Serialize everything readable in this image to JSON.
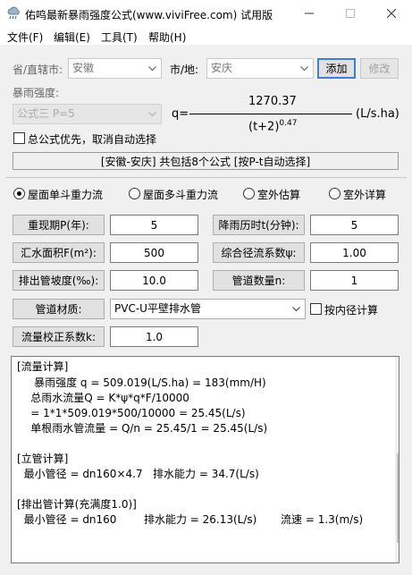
{
  "window": {
    "title": "佑鸣最新暴雨强度公式(www.viviFree.com) 试用版",
    "icon": "rain-cloud-icon"
  },
  "menu": [
    "文件(F)",
    "编辑(E)",
    "工具(T)",
    "帮助(H)"
  ],
  "location": {
    "province_label": "省/直辖市:",
    "province_value": "安徽",
    "city_label": "市/地:",
    "city_value": "安庆",
    "add_label": "添加",
    "edit_label": "修改"
  },
  "intensity": {
    "label": "暴雨强度:",
    "formula_select": "公式三 P=5",
    "q_prefix": "q=",
    "numerator": "1270.37",
    "denominator_base": "(t+2)",
    "denominator_exp": "0.47",
    "unit": "(L/s.ha)",
    "checkbox_label": "总公式优先，取消自动选择",
    "info": "[安徽-安庆] 共包括8个公式 [按P-t自动选择]"
  },
  "modes": [
    {
      "label": "屋面单斗重力流",
      "selected": true
    },
    {
      "label": "屋面多斗重力流",
      "selected": false
    },
    {
      "label": "室外估算",
      "selected": false
    },
    {
      "label": "室外详算",
      "selected": false
    }
  ],
  "params": {
    "return_period_label": "重现期P(年):",
    "return_period_value": "5",
    "duration_label": "降雨历时t(分钟):",
    "duration_value": "5",
    "area_label": "汇水面积F(m²):",
    "area_value": "500",
    "runoff_label": "综合径流系数ψ:",
    "runoff_value": "1.00",
    "slope_label": "排出管坡度(‰):",
    "slope_value": "10.0",
    "pipe_count_label": "管道数量n:",
    "pipe_count_value": "1",
    "material_label": "管道材质:",
    "material_value": "PVC-U平壁排水管",
    "inner_diam_label": "按内径计算",
    "flow_corr_label": "流量校正系数k:",
    "flow_corr_value": "1.0"
  },
  "results": [
    "[流量计算]",
    "     暴雨强度 q = 509.019(L/S.ha) = 183(mm/H)",
    "    总雨水流量Q = K*ψ*q*F/10000",
    "    = 1*1*509.019*500/10000 = 25.45(L/s)",
    "    单根雨水管流量 = Q/n = 25.45/1 = 25.45(L/s)",
    "",
    "[立管计算]",
    "  最小管径 = dn160×4.7   排水能力 = 34.7(L/s)",
    "",
    "[排出管计算(充满度1.0)]",
    "  最小管径 = dn160        排水能力 = 26.13(L/s)       流速 = 1.3(m/s)"
  ]
}
